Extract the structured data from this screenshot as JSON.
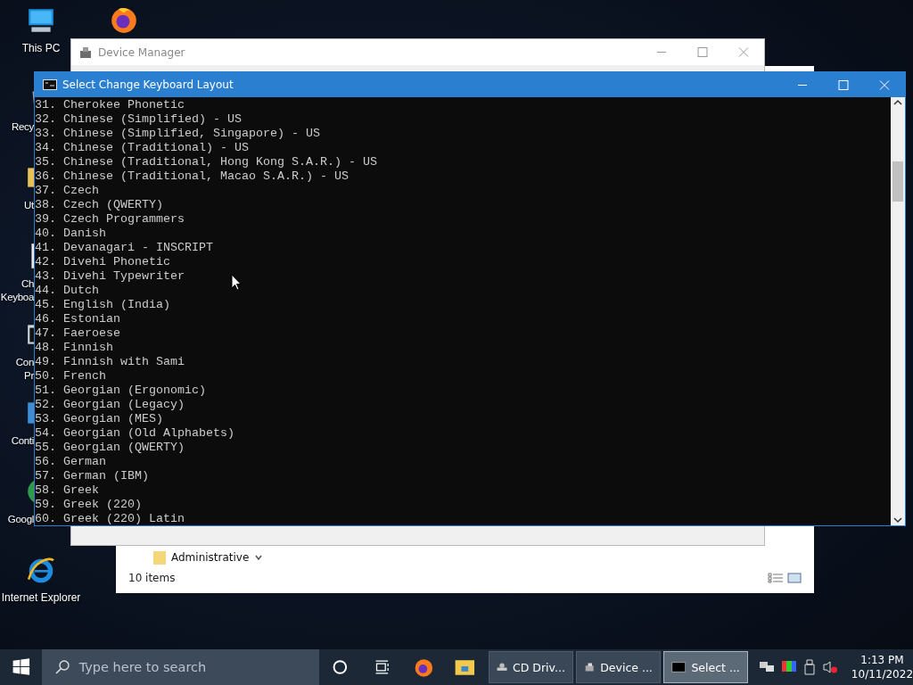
{
  "desktop_icons": [
    {
      "kind": "pc",
      "lines": [
        "This PC"
      ]
    },
    {
      "kind": "recycle",
      "lines": [
        "Recy"
      ]
    },
    {
      "kind": "folder",
      "lines": [
        "Ut"
      ]
    },
    {
      "kind": "file",
      "lines": [
        "Ch",
        "Keyboa"
      ]
    },
    {
      "kind": "console",
      "lines": [
        "Con",
        "Pr"
      ]
    },
    {
      "kind": "control",
      "lines": [
        "Conti"
      ]
    },
    {
      "kind": "chrome",
      "lines": [
        "Googl"
      ]
    },
    {
      "kind": "ie",
      "lines": [
        "Internet Explorer"
      ]
    }
  ],
  "explorer_window": {
    "items": [
      {
        "label": "Administrative"
      }
    ],
    "status": "10 items"
  },
  "device_manager": {
    "title": "Device Manager"
  },
  "console": {
    "title": "Select Change Keyboard Layout",
    "lines": [
      "31. Cherokee Phonetic",
      "32. Chinese (Simplified) - US",
      "33. Chinese (Simplified, Singapore) - US",
      "34. Chinese (Traditional) - US",
      "35. Chinese (Traditional, Hong Kong S.A.R.) - US",
      "36. Chinese (Traditional, Macao S.A.R.) - US",
      "37. Czech",
      "38. Czech (QWERTY)",
      "39. Czech Programmers",
      "40. Danish",
      "41. Devanagari - INSCRIPT",
      "42. Divehi Phonetic",
      "43. Divehi Typewriter",
      "44. Dutch",
      "45. English (India)",
      "46. Estonian",
      "47. Faeroese",
      "48. Finnish",
      "49. Finnish with Sami",
      "50. French",
      "51. Georgian (Ergonomic)",
      "52. Georgian (Legacy)",
      "53. Georgian (MES)",
      "54. Georgian (Old Alphabets)",
      "55. Georgian (QWERTY)",
      "56. German",
      "57. German (IBM)",
      "58. Greek",
      "59. Greek (220)",
      "60. Greek (220) Latin"
    ]
  },
  "taskbar": {
    "search_placeholder": "Type here to search",
    "buttons": [
      {
        "kind": "cd",
        "label": "CD Driv...",
        "selected": false
      },
      {
        "kind": "device",
        "label": "Device ...",
        "selected": false
      },
      {
        "kind": "console",
        "label": "Select ...",
        "selected": true
      }
    ],
    "time": "1:13 PM",
    "date": "10/11/2022"
  }
}
